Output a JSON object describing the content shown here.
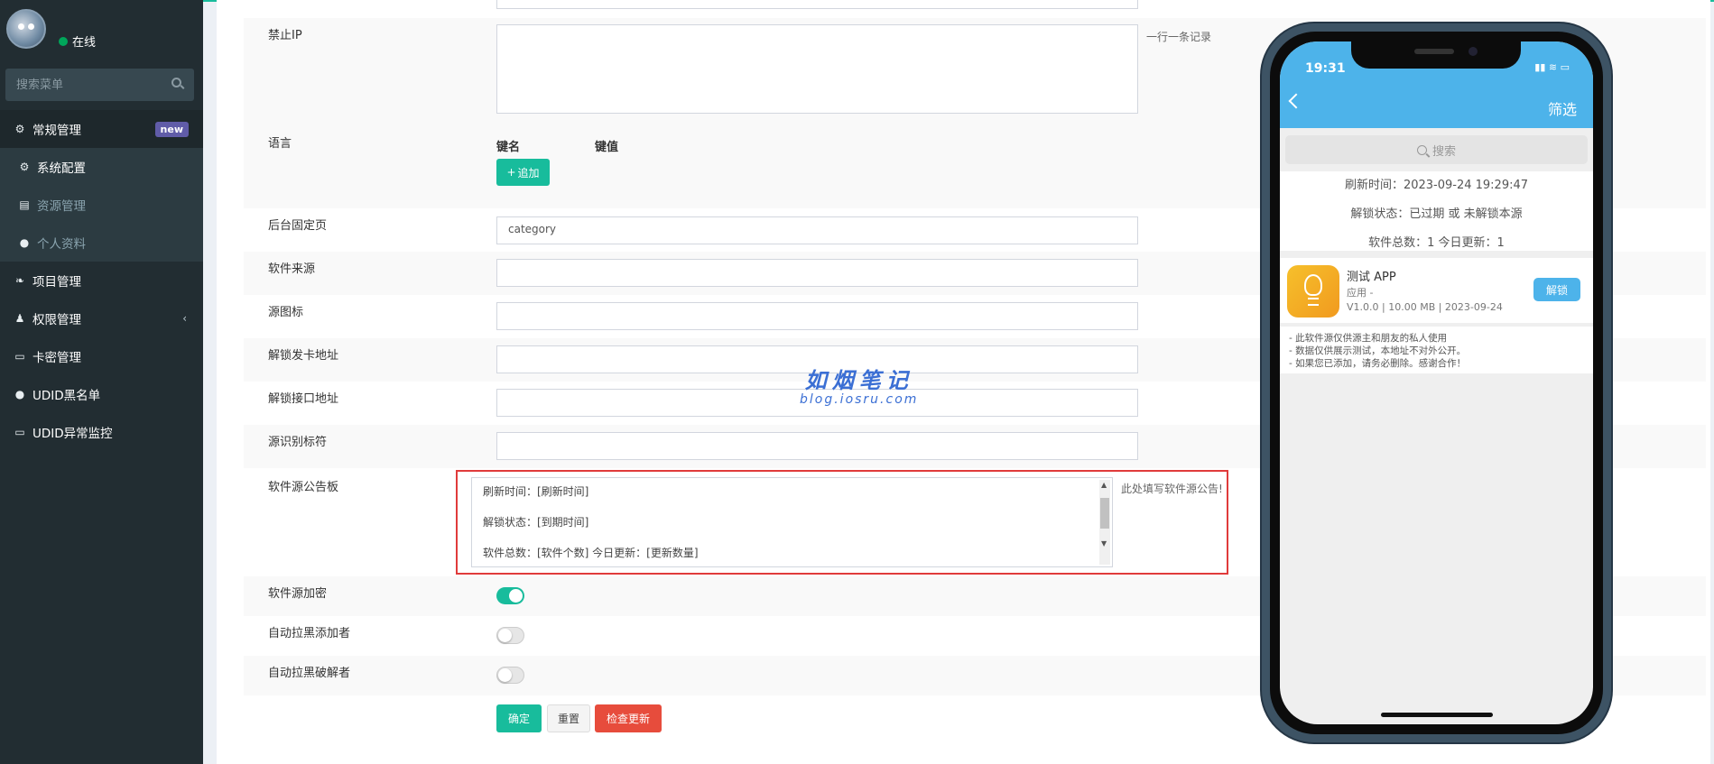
{
  "sidebar": {
    "status": "在线",
    "search_placeholder": "搜索菜单",
    "menu": [
      {
        "label": "常规管理",
        "icon": "cogs-icon",
        "badge": "new"
      },
      {
        "label": "系统配置",
        "icon": "gear-icon"
      },
      {
        "label": "资源管理",
        "icon": "file-image-icon"
      },
      {
        "label": "个人资料",
        "icon": "user-icon"
      },
      {
        "label": "项目管理",
        "icon": "leaf-icon"
      },
      {
        "label": "权限管理",
        "icon": "group-icon"
      },
      {
        "label": "卡密管理",
        "icon": "card-icon"
      },
      {
        "label": "UDID黑名单",
        "icon": "bomb-icon"
      },
      {
        "label": "UDID异常监控",
        "icon": "desktop-icon"
      }
    ]
  },
  "form": {
    "ban_ip_label": "禁止IP",
    "ban_ip_hint": "一行一条记录",
    "lang_label": "语言",
    "key_header": "键名",
    "value_header": "键值",
    "add_button": "追加",
    "fixed_page_label": "后台固定页",
    "fixed_page_value": "category",
    "source_label": "软件来源",
    "source_icon_label": "源图标",
    "unlock_card_label": "解锁发卡地址",
    "unlock_api_label": "解锁接口地址",
    "source_id_label": "源识别标符",
    "notice_label": "软件源公告板",
    "notice_lines": [
      "刷新时间：[刷新时间]",
      "解锁状态：[到期时间]",
      "软件总数：[软件个数]    今日更新：[更新数量]"
    ],
    "notice_hint": "此处填写软件源公告!",
    "encrypt_label": "软件源加密",
    "encrypt_on": true,
    "auto_block_add_label": "自动拉黑添加者",
    "auto_block_add_on": false,
    "auto_block_crack_label": "自动拉黑破解者",
    "auto_block_crack_on": false,
    "confirm_button": "确定",
    "reset_button": "重置",
    "check_update_button": "检查更新"
  },
  "watermark": {
    "title": "如烟笔记",
    "url": "blog.iosru.com"
  },
  "phone": {
    "time": "19:31",
    "filter": "筛选",
    "search_placeholder": "搜索",
    "refresh_time": "刷新时间：2023-09-24 19:29:47",
    "unlock_status": "解锁状态：已过期 或 未解锁本源",
    "counts": "软件总数：1    今日更新：1",
    "app_name": "测试 APP",
    "app_type": "应用 -",
    "app_meta": "V1.0.0 | 10.00 MB | 2023-09-24",
    "unlock_button": "解锁",
    "notes": [
      "- 此软件源仅供源主和朋友的私人使用",
      "- 数据仅供展示测试，本地址不对外公开。",
      "- 如果您已添加，请务必删除。感谢合作！"
    ]
  },
  "colors": {
    "accent": "#18bc9c",
    "danger": "#e74c3c",
    "sidebar": "#222d32",
    "phone_header": "#4db3ea",
    "highlight": "#e03b3b"
  }
}
